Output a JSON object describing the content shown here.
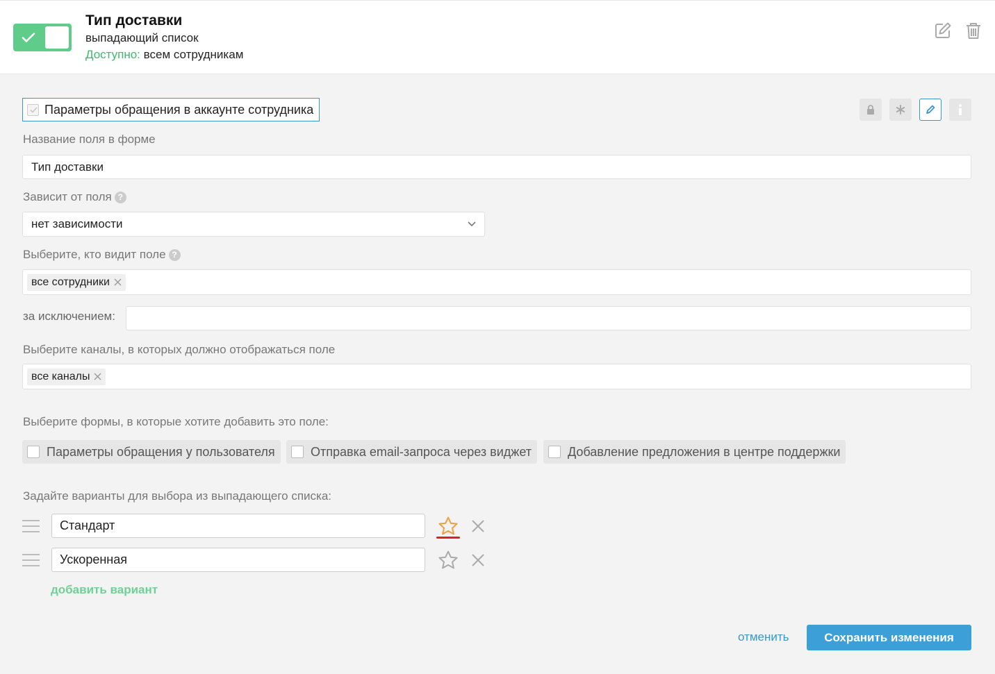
{
  "header": {
    "title": "Тип доставки",
    "subtitle": "выпадающий список",
    "available_label": "Доступно:",
    "available_value": "всем сотрудникам",
    "toggle_on": true,
    "accent": "#5fcc8a"
  },
  "form_checkbox": {
    "label": "Параметры обращения в аккаунте сотрудника",
    "checked": true
  },
  "tools": [
    "lock-icon",
    "asterisk-icon",
    "pencil-icon",
    "info-icon"
  ],
  "field_name": {
    "label": "Название поля в форме",
    "value": "Тип доставки"
  },
  "depends_on": {
    "label": "Зависит от поля",
    "help": "?",
    "value": "нет зависимости"
  },
  "visibility": {
    "label": "Выберите, кто видит поле",
    "help": "?",
    "chips": [
      "все сотрудники"
    ],
    "except_label": "за исключением:",
    "except_value": ""
  },
  "channels": {
    "label": "Выберите каналы, в которых должно отображаться поле",
    "chips": [
      "все каналы"
    ]
  },
  "forms": {
    "label": "Выберите формы, в которые хотите добавить это поле:",
    "options": [
      {
        "label": "Параметры обращения у пользователя",
        "checked": false
      },
      {
        "label": "Отправка email-запроса через виджет",
        "checked": false
      },
      {
        "label": "Добавление предложения в центре поддержки",
        "checked": false
      }
    ]
  },
  "variants": {
    "label": "Задайте варианты для выбора из выпадающего списка:",
    "items": [
      {
        "value": "Стандарт",
        "default": true
      },
      {
        "value": "Ускоренная",
        "default": false
      }
    ],
    "add_label": "добавить вариант"
  },
  "actions": {
    "cancel_label": "отменить",
    "save_label": "Сохранить изменения",
    "save_color": "#3d9fd8"
  }
}
